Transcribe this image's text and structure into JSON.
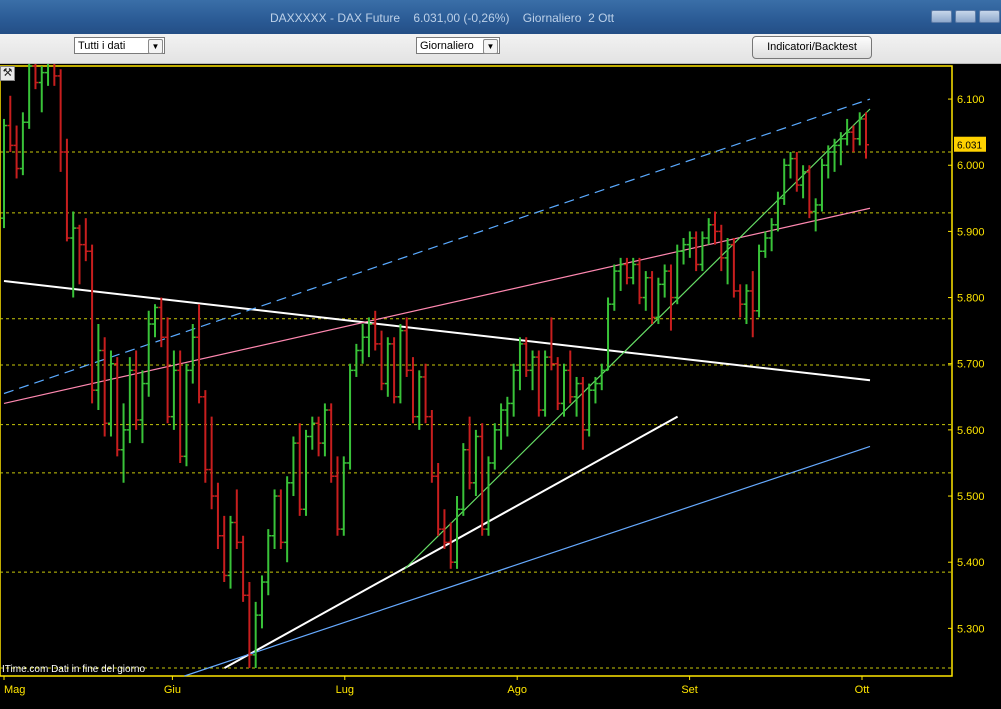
{
  "window": {
    "title": "DAXXXXX - DAX Future    6.031,00 (-0,26%)    Giornaliero  2 Ott"
  },
  "toolbar": {
    "range_select": "Tutti i dati",
    "period_select": "Giornaliero",
    "indicators_button": "Indicatori/Backtest"
  },
  "source_note": "ITime.com  Dati in fine del giorno",
  "chart_data": {
    "type": "ohlc",
    "instrument": "DAX Future",
    "last_value_label": "6.031",
    "ylim": [
      5228,
      6150
    ],
    "y_ticks": [
      "6.100",
      "6.000",
      "5.900",
      "5.800",
      "5.700",
      "5.600",
      "5.500",
      "5.400",
      "5.300"
    ],
    "y_tick_values": [
      6100,
      6000,
      5900,
      5800,
      5700,
      5600,
      5500,
      5400,
      5300
    ],
    "x_ticks": [
      "Mag",
      "Giu",
      "Lug",
      "Ago",
      "Set",
      "Ott"
    ],
    "x_tick_index": [
      0,
      42,
      85,
      128,
      171,
      214
    ],
    "n_bars": 216,
    "grid": "horizontal dashed yellow",
    "horizontal_levels": [
      6020,
      5928,
      5768,
      5698,
      5608,
      5535,
      5385,
      5240
    ],
    "colors": {
      "up": "#39c339",
      "down": "#c81e1e",
      "grid": "#c8c80a",
      "axis_text": "#ffe600",
      "last_bg": "#ffd200"
    },
    "bars": [
      [
        5920,
        6070,
        5905,
        6060
      ],
      [
        6060,
        6105,
        6020,
        6030
      ],
      [
        6030,
        6060,
        5980,
        5995
      ],
      [
        5995,
        6080,
        5985,
        6065
      ],
      [
        6065,
        6165,
        6055,
        6150
      ],
      [
        6150,
        6155,
        6115,
        6125
      ],
      [
        6125,
        6150,
        6080,
        6140
      ],
      [
        6140,
        6185,
        6120,
        6170
      ],
      [
        6170,
        6175,
        6120,
        6135
      ],
      [
        6135,
        6145,
        5990,
        6020
      ],
      [
        6020,
        6040,
        5885,
        5890
      ],
      [
        5890,
        5930,
        5800,
        5905
      ],
      [
        5905,
        5910,
        5820,
        5880
      ],
      [
        5880,
        5920,
        5855,
        5870
      ],
      [
        5870,
        5880,
        5640,
        5660
      ],
      [
        5660,
        5760,
        5630,
        5720
      ],
      [
        5720,
        5740,
        5590,
        5610
      ],
      [
        5610,
        5720,
        5590,
        5700
      ],
      [
        5700,
        5710,
        5560,
        5570
      ],
      [
        5570,
        5640,
        5520,
        5600
      ],
      [
        5600,
        5710,
        5580,
        5690
      ],
      [
        5690,
        5720,
        5600,
        5615
      ],
      [
        5615,
        5690,
        5580,
        5670
      ],
      [
        5670,
        5780,
        5650,
        5760
      ],
      [
        5760,
        5790,
        5740,
        5785
      ],
      [
        5785,
        5800,
        5725,
        5740
      ],
      [
        5740,
        5770,
        5610,
        5620
      ],
      [
        5620,
        5720,
        5600,
        5690
      ],
      [
        5690,
        5720,
        5550,
        5560
      ],
      [
        5560,
        5700,
        5545,
        5690
      ],
      [
        5690,
        5760,
        5670,
        5740
      ],
      [
        5740,
        5790,
        5640,
        5650
      ],
      [
        5650,
        5660,
        5520,
        5540
      ],
      [
        5540,
        5620,
        5480,
        5500
      ],
      [
        5500,
        5520,
        5420,
        5440
      ],
      [
        5440,
        5470,
        5370,
        5380
      ],
      [
        5380,
        5470,
        5360,
        5460
      ],
      [
        5460,
        5510,
        5420,
        5430
      ],
      [
        5430,
        5440,
        5340,
        5350
      ],
      [
        5350,
        5370,
        5240,
        5260
      ],
      [
        5260,
        5340,
        5240,
        5320
      ],
      [
        5320,
        5380,
        5300,
        5370
      ],
      [
        5370,
        5450,
        5350,
        5440
      ],
      [
        5440,
        5510,
        5420,
        5500
      ],
      [
        5500,
        5510,
        5420,
        5430
      ],
      [
        5430,
        5530,
        5400,
        5520
      ],
      [
        5520,
        5590,
        5500,
        5580
      ],
      [
        5580,
        5610,
        5470,
        5480
      ],
      [
        5480,
        5600,
        5470,
        5590
      ],
      [
        5590,
        5620,
        5570,
        5610
      ],
      [
        5610,
        5620,
        5560,
        5580
      ],
      [
        5580,
        5640,
        5560,
        5630
      ],
      [
        5630,
        5640,
        5520,
        5530
      ],
      [
        5530,
        5560,
        5440,
        5450
      ],
      [
        5450,
        5560,
        5440,
        5550
      ],
      [
        5550,
        5700,
        5540,
        5690
      ],
      [
        5690,
        5730,
        5680,
        5720
      ],
      [
        5720,
        5760,
        5700,
        5740
      ],
      [
        5740,
        5770,
        5710,
        5760
      ],
      [
        5760,
        5780,
        5720,
        5730
      ],
      [
        5730,
        5750,
        5660,
        5670
      ],
      [
        5670,
        5740,
        5650,
        5730
      ],
      [
        5730,
        5740,
        5640,
        5650
      ],
      [
        5650,
        5760,
        5640,
        5750
      ],
      [
        5750,
        5770,
        5680,
        5690
      ],
      [
        5690,
        5710,
        5610,
        5620
      ],
      [
        5620,
        5690,
        5600,
        5680
      ],
      [
        5680,
        5700,
        5610,
        5620
      ],
      [
        5620,
        5630,
        5520,
        5530
      ],
      [
        5530,
        5550,
        5440,
        5450
      ],
      [
        5450,
        5480,
        5420,
        5430
      ],
      [
        5430,
        5460,
        5390,
        5400
      ],
      [
        5400,
        5500,
        5390,
        5480
      ],
      [
        5480,
        5580,
        5470,
        5570
      ],
      [
        5570,
        5620,
        5510,
        5520
      ],
      [
        5520,
        5600,
        5500,
        5590
      ],
      [
        5590,
        5610,
        5440,
        5450
      ],
      [
        5450,
        5560,
        5440,
        5550
      ],
      [
        5550,
        5610,
        5540,
        5600
      ],
      [
        5600,
        5640,
        5570,
        5630
      ],
      [
        5630,
        5650,
        5590,
        5640
      ],
      [
        5640,
        5700,
        5620,
        5690
      ],
      [
        5690,
        5740,
        5660,
        5730
      ],
      [
        5730,
        5740,
        5680,
        5690
      ],
      [
        5690,
        5720,
        5660,
        5710
      ],
      [
        5710,
        5720,
        5620,
        5630
      ],
      [
        5630,
        5720,
        5620,
        5710
      ],
      [
        5710,
        5770,
        5690,
        5700
      ],
      [
        5700,
        5710,
        5630,
        5640
      ],
      [
        5640,
        5700,
        5620,
        5690
      ],
      [
        5690,
        5720,
        5640,
        5650
      ],
      [
        5650,
        5680,
        5620,
        5670
      ],
      [
        5670,
        5680,
        5570,
        5600
      ],
      [
        5600,
        5670,
        5590,
        5660
      ],
      [
        5660,
        5680,
        5640,
        5670
      ],
      [
        5670,
        5700,
        5660,
        5690
      ],
      [
        5690,
        5800,
        5690,
        5790
      ],
      [
        5790,
        5850,
        5780,
        5840
      ],
      [
        5840,
        5860,
        5810,
        5850
      ],
      [
        5850,
        5860,
        5820,
        5830
      ],
      [
        5830,
        5860,
        5820,
        5850
      ],
      [
        5850,
        5860,
        5790,
        5800
      ],
      [
        5800,
        5840,
        5780,
        5830
      ],
      [
        5830,
        5840,
        5760,
        5770
      ],
      [
        5770,
        5830,
        5760,
        5820
      ],
      [
        5820,
        5850,
        5800,
        5840
      ],
      [
        5840,
        5850,
        5750,
        5800
      ],
      [
        5800,
        5880,
        5790,
        5870
      ],
      [
        5870,
        5890,
        5850,
        5880
      ],
      [
        5880,
        5900,
        5860,
        5890
      ],
      [
        5890,
        5900,
        5840,
        5850
      ],
      [
        5850,
        5900,
        5840,
        5890
      ],
      [
        5890,
        5920,
        5880,
        5910
      ],
      [
        5910,
        5930,
        5880,
        5900
      ],
      [
        5900,
        5910,
        5840,
        5860
      ],
      [
        5860,
        5890,
        5820,
        5880
      ],
      [
        5880,
        5890,
        5800,
        5810
      ],
      [
        5810,
        5820,
        5770,
        5790
      ],
      [
        5790,
        5820,
        5760,
        5810
      ],
      [
        5810,
        5840,
        5740,
        5780
      ],
      [
        5780,
        5880,
        5770,
        5870
      ],
      [
        5870,
        5900,
        5860,
        5890
      ],
      [
        5890,
        5920,
        5870,
        5910
      ],
      [
        5910,
        5960,
        5900,
        5950
      ],
      [
        5950,
        6010,
        5940,
        6000
      ],
      [
        6000,
        6020,
        5980,
        6010
      ],
      [
        6010,
        6020,
        5960,
        5970
      ],
      [
        5970,
        6000,
        5950,
        5990
      ],
      [
        5990,
        6000,
        5920,
        5930
      ],
      [
        5930,
        5950,
        5900,
        5940
      ],
      [
        5940,
        6010,
        5930,
        6000
      ],
      [
        6000,
        6030,
        5980,
        6020
      ],
      [
        6020,
        6040,
        5990,
        6030
      ],
      [
        6030,
        6050,
        6000,
        6040
      ],
      [
        6040,
        6070,
        6030,
        6050
      ],
      [
        6050,
        6060,
        6020,
        6040
      ],
      [
        6040,
        6080,
        6030,
        6070
      ],
      [
        6070,
        6080,
        6010,
        6031
      ]
    ],
    "trendlines": [
      {
        "style": "solid",
        "color": "#ffffff",
        "x1": 0,
        "y1": 5825,
        "x2": 216,
        "y2": 5675
      },
      {
        "style": "solid",
        "color": "#ff88b0",
        "x1": 0,
        "y1": 5640,
        "x2": 216,
        "y2": 5935
      },
      {
        "style": "dashed",
        "color": "#5aaaff",
        "x1": 0,
        "y1": 5655,
        "x2": 216,
        "y2": 6100
      },
      {
        "style": "solid",
        "color": "#ffffff",
        "x1": 55,
        "y1": 5240,
        "x2": 168,
        "y2": 5620
      },
      {
        "style": "solid",
        "color": "#66aaff",
        "x1": 45,
        "y1": 5228,
        "x2": 216,
        "y2": 5575
      },
      {
        "style": "solid",
        "color": "#66dd66",
        "x1": 100,
        "y1": 5390,
        "x2": 216,
        "y2": 6085
      }
    ]
  }
}
